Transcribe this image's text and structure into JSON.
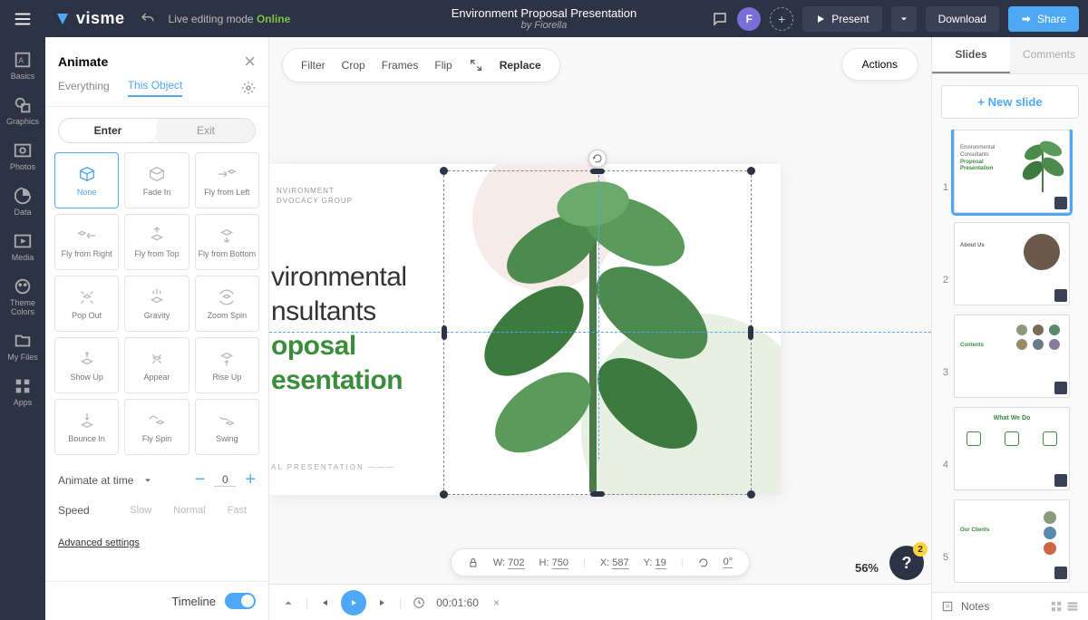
{
  "topbar": {
    "logo": "visme",
    "editing_mode": "Live editing mode",
    "online": "Online",
    "title": "Environment Proposal Presentation",
    "by": "by Fiorella",
    "avatar_letter": "F",
    "present": "Present",
    "download": "Download",
    "share": "Share"
  },
  "rail": {
    "basics": "Basics",
    "graphics": "Graphics",
    "photos": "Photos",
    "data": "Data",
    "media": "Media",
    "theme": "Theme Colors",
    "myfiles": "My Files",
    "apps": "Apps"
  },
  "panel": {
    "title": "Animate",
    "tab_everything": "Everything",
    "tab_this": "This Object",
    "enter": "Enter",
    "exit": "Exit",
    "animate_at": "Animate at time",
    "animate_val": "0",
    "speed": "Speed",
    "slow": "Slow",
    "normal": "Normal",
    "fast": "Fast",
    "advanced": "Advanced settings",
    "timeline": "Timeline",
    "anims": [
      "None",
      "Fade In",
      "Fly from Left",
      "Fly from Right",
      "Fly from Top",
      "Fly from Bottom",
      "Pop Out",
      "Gravity",
      "Zoom Spin",
      "Show Up",
      "Appear",
      "Rise Up",
      "Bounce In",
      "Fly Spin",
      "Swing"
    ]
  },
  "toolbar": {
    "filter": "Filter",
    "crop": "Crop",
    "frames": "Frames",
    "flip": "Flip",
    "replace": "Replace",
    "actions": "Actions"
  },
  "slide": {
    "header1": "NVIRONMENT",
    "header2": "DVOCACY GROUP",
    "b1": "vironmental",
    "b2": "nsultants",
    "b3": "oposal",
    "b4": "esentation",
    "footer": "AL PRESENTATION"
  },
  "status": {
    "w_label": "W:",
    "w": "702",
    "h_label": "H:",
    "h": "750",
    "x_label": "X:",
    "x": "587",
    "y_label": "Y:",
    "y": "19",
    "r": "0°",
    "zoom": "56%",
    "help_badge": "2"
  },
  "playback": {
    "time": "00:01:60"
  },
  "right": {
    "slides": "Slides",
    "comments": "Comments",
    "new": "New slide",
    "notes": "Notes",
    "thumbs": [
      "1",
      "2",
      "3",
      "4",
      "5"
    ],
    "t1_l1": "Environmental",
    "t1_l2": "Consultants",
    "t1_l3": "Proposal",
    "t1_l4": "Presentation",
    "t2": "About Us",
    "t3": "Contents",
    "t4": "What We Do",
    "t5": "Our Clients"
  }
}
